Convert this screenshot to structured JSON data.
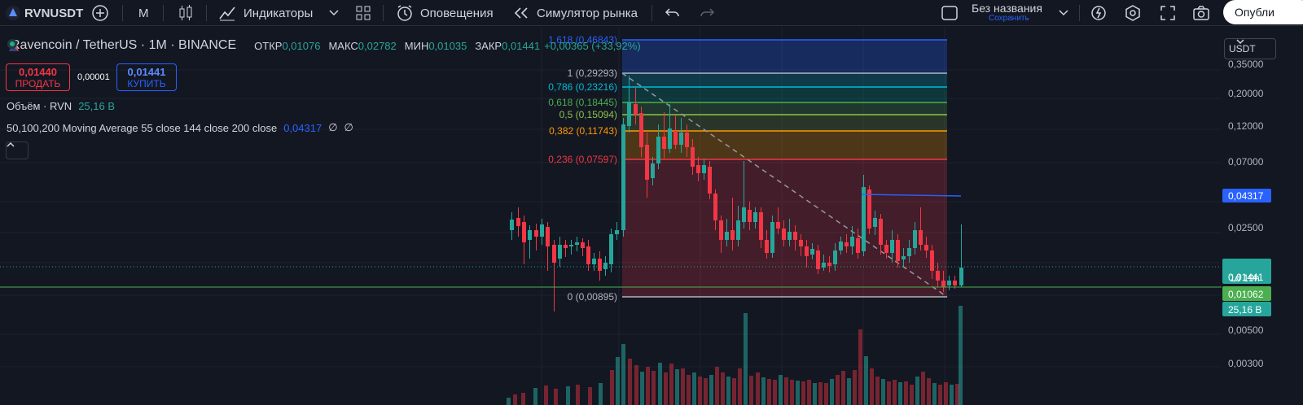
{
  "toolbar": {
    "symbol": "RVNUSDT",
    "interval": "M",
    "indicators_label": "Индикаторы",
    "alerts_label": "Оповещения",
    "replay_label": "Симулятор рынка",
    "layout_name": "Без названия",
    "save_label": "Сохранить",
    "publish_label": "Опубли"
  },
  "legend": {
    "pair": "Ravencoin / TetherUS · 1M · BINANCE",
    "open_label": "ОТКР",
    "open": "0,01076",
    "high_label": "МАКС",
    "high": "0,02782",
    "low_label": "МИН",
    "low": "0,01035",
    "close_label": "ЗАКР",
    "close": "0,01441",
    "change": "+0,00365 (+33,92%)",
    "volume_label": "Объём · RVN",
    "volume_value": "25,16 B",
    "ma_label": "50,100,200 Moving Average 55 close 144 close 200 close",
    "ma_value": "0,04317",
    "ma_empty1": "∅",
    "ma_empty2": "∅"
  },
  "trade": {
    "sell_price": "0,01440",
    "sell_label": "ПРОДАТЬ",
    "spread": "0,00001",
    "buy_price": "0,01441",
    "buy_label": "КУПИТЬ"
  },
  "currency": "USDT",
  "price_axis": {
    "ticks": [
      "0,35000",
      "0,20000",
      "0,12000",
      "0,07000",
      "0,02500",
      "0,00500",
      "0,00300"
    ],
    "ma_tag": "0,04317",
    "last_price": "0,01441",
    "countdown": "1d 19h",
    "hline_price": "0,01062",
    "volume_tag": "25,16 B"
  },
  "fib_levels": [
    {
      "ratio": "1,618",
      "price": "0,46843",
      "color": "#2962ff"
    },
    {
      "ratio": "1",
      "price": "0,29293",
      "color": "#b2b5be"
    },
    {
      "ratio": "0,786",
      "price": "0,23216",
      "color": "#00bcd4"
    },
    {
      "ratio": "0,618",
      "price": "0,18445",
      "color": "#4caf50"
    },
    {
      "ratio": "0,5",
      "price": "0,15094",
      "color": "#8bc34a"
    },
    {
      "ratio": "0,382",
      "price": "0,11743",
      "color": "#ff9800"
    },
    {
      "ratio": "0,236",
      "price": "0,07597",
      "color": "#f23645"
    },
    {
      "ratio": "0",
      "price": "0,00895",
      "color": "#b2b5be"
    }
  ],
  "colors": {
    "up": "#26a69a",
    "down": "#f23645",
    "ma": "#2962ff",
    "hline": "#4caf50",
    "background": "#131722"
  }
}
